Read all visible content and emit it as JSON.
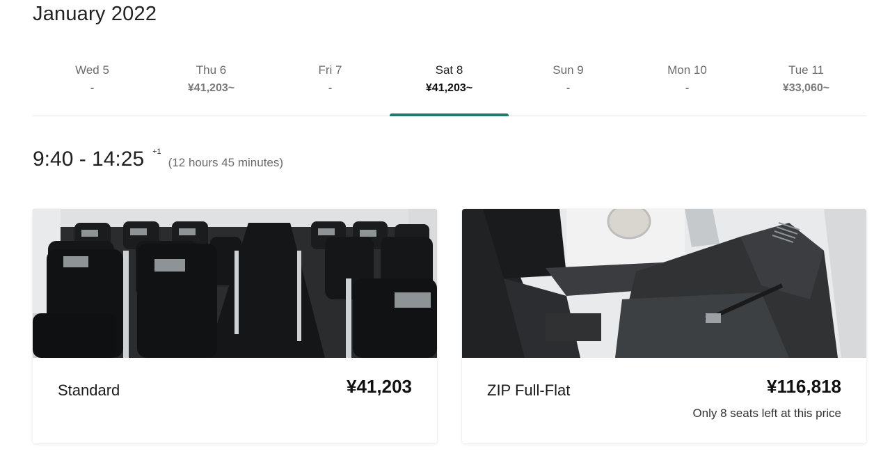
{
  "header": {
    "month": "January 2022"
  },
  "dates": [
    {
      "day": "Wed 5",
      "price": "-"
    },
    {
      "day": "Thu 6",
      "price": "¥41,203~"
    },
    {
      "day": "Fri 7",
      "price": "-"
    },
    {
      "day": "Sat 8",
      "price": "¥41,203~"
    },
    {
      "day": "Sun 9",
      "price": "-"
    },
    {
      "day": "Mon 10",
      "price": "-"
    },
    {
      "day": "Tue 11",
      "price": "¥33,060~"
    }
  ],
  "selected_date_index": 3,
  "flight": {
    "times": "9:40 - 14:25",
    "day_offset": "+1",
    "duration": "(12 hours 45 minutes)"
  },
  "fares": [
    {
      "name": "Standard",
      "price": "¥41,203",
      "note": ""
    },
    {
      "name": "ZIP Full-Flat",
      "price": "¥116,818",
      "note": "Only 8 seats left at this price"
    }
  ],
  "colors": {
    "accent": "#1f7a66"
  }
}
